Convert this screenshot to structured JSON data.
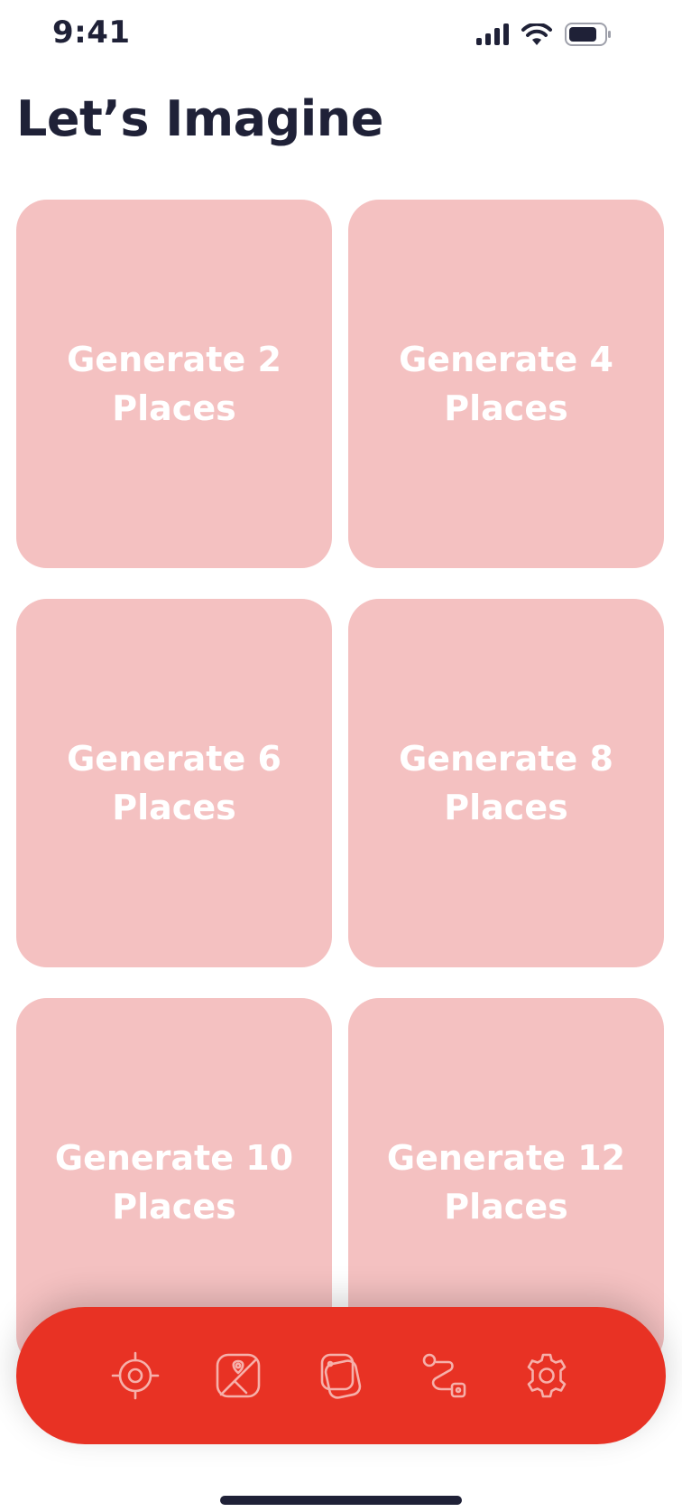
{
  "status_bar": {
    "time": "9:41",
    "icons": [
      "signal-icon",
      "wifi-icon",
      "battery-icon"
    ]
  },
  "page": {
    "title": "Let’s Imagine"
  },
  "cards": [
    {
      "label": "Generate 2 Places"
    },
    {
      "label": "Generate 4 Places"
    },
    {
      "label": "Generate 6 Places"
    },
    {
      "label": "Generate 8 Places"
    },
    {
      "label": "Generate 10 Places"
    },
    {
      "label": "Generate 12 Places"
    }
  ],
  "tab_bar": {
    "items": [
      {
        "icon": "crosshair-icon"
      },
      {
        "icon": "map-pin-image-icon"
      },
      {
        "icon": "stacked-cards-icon"
      },
      {
        "icon": "route-icon"
      },
      {
        "icon": "gear-icon"
      }
    ]
  },
  "colors": {
    "title_text": "#1f2137",
    "card_background": "#f4c1c1",
    "card_text": "#ffffff",
    "tab_bar_background": "#e83224",
    "tab_icon": "#f6b0aa"
  }
}
